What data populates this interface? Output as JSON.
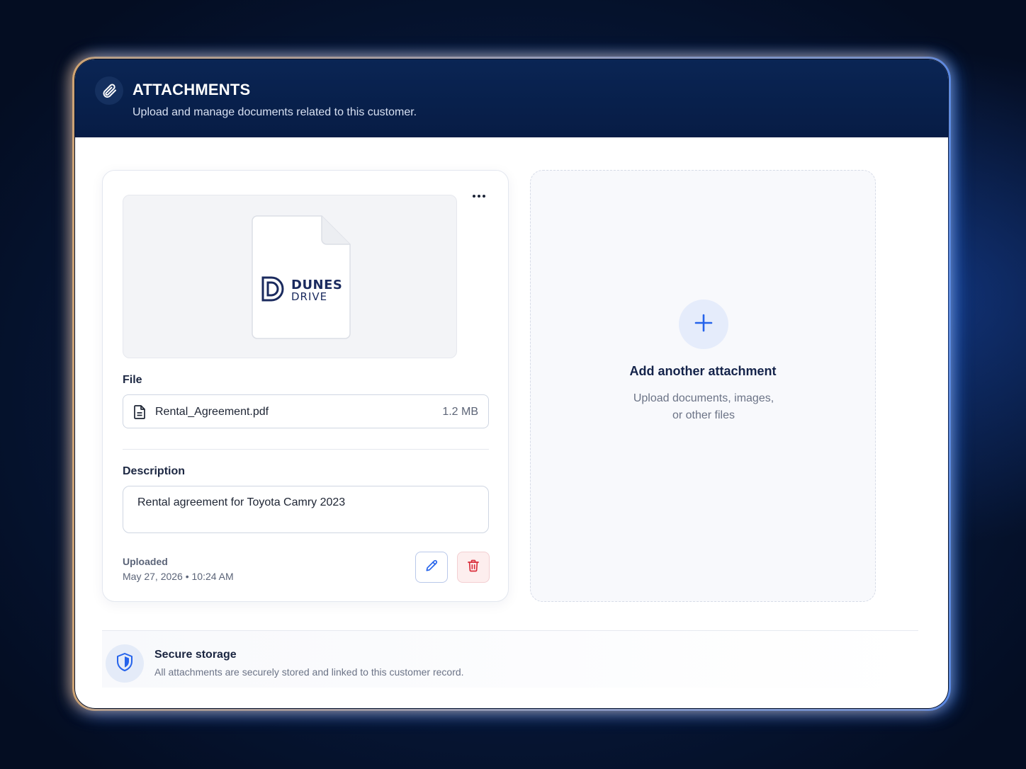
{
  "header": {
    "icon": "paperclip-icon",
    "title": "ATTACHMENTS",
    "subtitle": "Upload and manage documents related to this customer."
  },
  "attachment": {
    "preview_icon": "document-icon",
    "logo": {
      "line1": "DUNES",
      "line2": "DRIVE"
    },
    "more_icon": "more-horizontal-icon",
    "file_label": "File",
    "file_name": "Rental_Agreement.pdf",
    "file_size": "1.2 MB",
    "description_label": "Description",
    "description_value": "Rental agreement for Toyota Camry 2023",
    "uploaded_label": "Uploaded",
    "uploaded_date": "May 27, 2026 • 10:24 AM",
    "edit_icon": "pencil-icon",
    "delete_icon": "trash-icon"
  },
  "add_attachment": {
    "icon": "plus-icon",
    "title": "Add another attachment",
    "subtitle_line1": "Upload documents, images,",
    "subtitle_line2": "or other files"
  },
  "footer": {
    "icon": "shield-icon",
    "title": "Secure storage",
    "subtitle": "All attachments are securely stored and linked to this customer record."
  },
  "colors": {
    "header_bg": "#0a2554",
    "accent_blue": "#2563eb",
    "danger_red": "#d92d3a",
    "glow_orange": "#ffb347",
    "glow_blue": "#3a7dff"
  }
}
